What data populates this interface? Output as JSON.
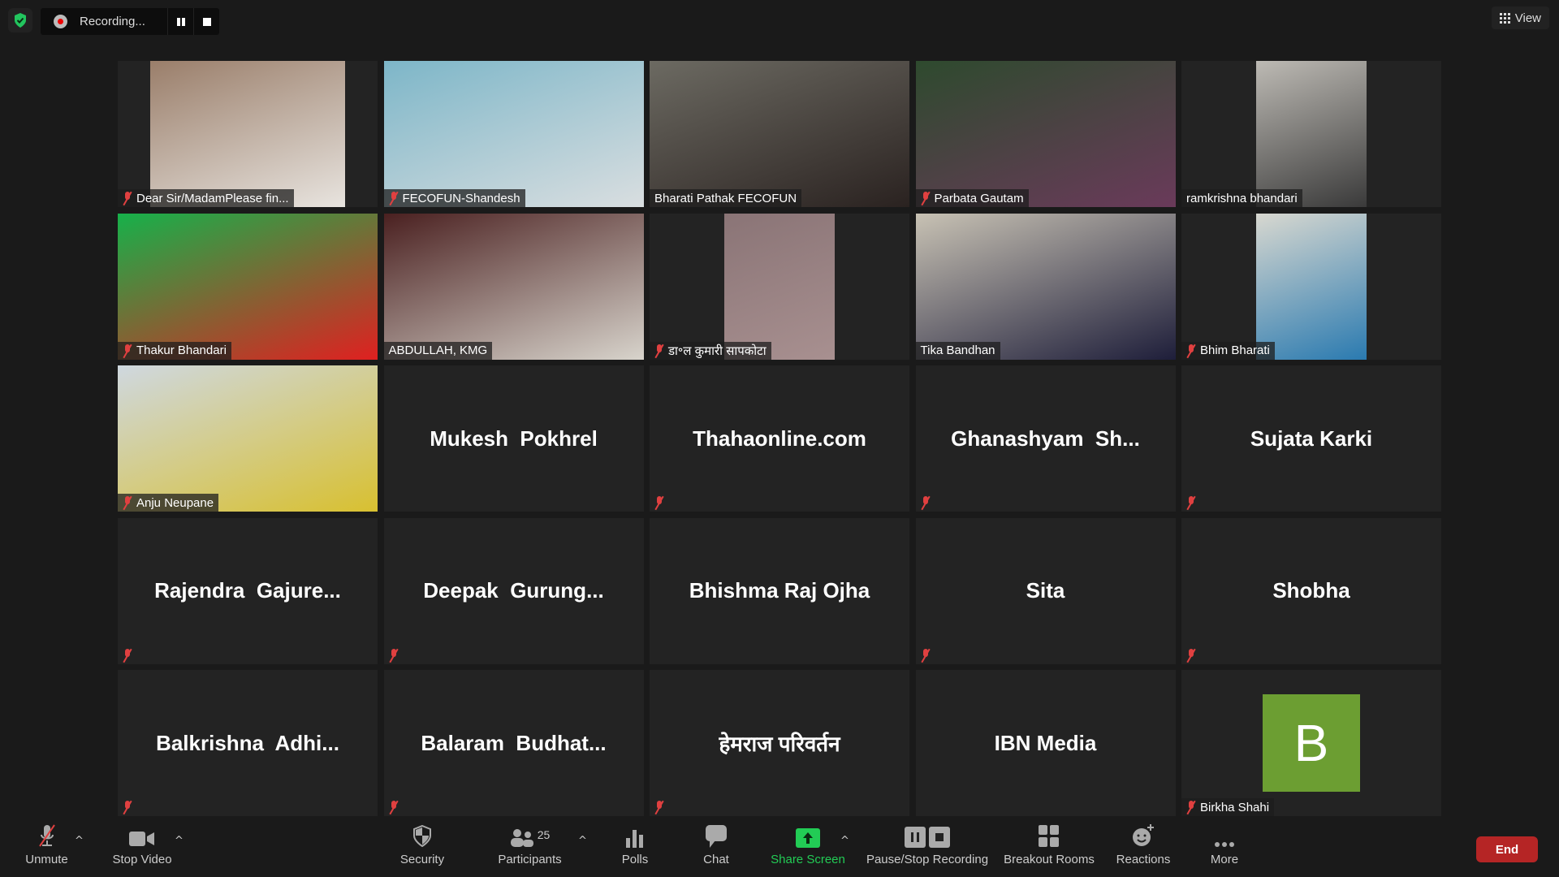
{
  "topbar": {
    "security_icon": "shield-check-icon",
    "recording_label": "Recording...",
    "view_label": "View"
  },
  "tiles": [
    {
      "name": "Dear Sir/MadamPlease fin...",
      "muted": true,
      "video": true,
      "colors": [
        "#9a7e6a",
        "#e8e4df"
      ]
    },
    {
      "name": "FECOFUN-Shandesh",
      "muted": true,
      "video": true,
      "colors": [
        "#7db6c8",
        "#d9dee0"
      ]
    },
    {
      "name": "Bharati Pathak FECOFUN",
      "muted": false,
      "video": true,
      "colors": [
        "#6c6a62",
        "#2a2220"
      ]
    },
    {
      "name": "Parbata Gautam",
      "muted": true,
      "video": true,
      "colors": [
        "#2e4a2e",
        "#6a3a5a"
      ]
    },
    {
      "name": "ramkrishna bhandari",
      "muted": false,
      "video": true,
      "colors": [
        "#bdbab4",
        "#3a3a3a"
      ]
    },
    {
      "name": "Thakur Bhandari",
      "muted": true,
      "video": true,
      "colors": [
        "#16b14a",
        "#e02020"
      ]
    },
    {
      "name": "ABDULLAH, KMG",
      "muted": false,
      "video": true,
      "colors": [
        "#4a2020",
        "#d8d4cc"
      ]
    },
    {
      "name": "डा॰ल कुमारी सापकोटा",
      "muted": true,
      "video": true,
      "colors": [
        "#8a7476",
        "#a89090"
      ]
    },
    {
      "name": "Tika Bandhan",
      "muted": false,
      "video": true,
      "active": true,
      "colors": [
        "#c8c2b4",
        "#1e1e3a"
      ]
    },
    {
      "name": "Bhim Bharati",
      "muted": true,
      "video": true,
      "colors": [
        "#d8d8d0",
        "#2a7ab0"
      ]
    },
    {
      "name": "Anju Neupane",
      "muted": true,
      "video": true,
      "colors": [
        "#cfd8e0",
        "#d8c030"
      ]
    },
    {
      "display": "Mukesh  Pokhrel",
      "muted": false
    },
    {
      "display": "Thahaonline.com",
      "muted": true
    },
    {
      "display": "Ghanashyam  Sh...",
      "muted": true
    },
    {
      "display": "Sujata Karki",
      "muted": true
    },
    {
      "display": "Rajendra  Gajure...",
      "muted": true
    },
    {
      "display": "Deepak  Gurung...",
      "muted": true
    },
    {
      "display": "Bhishma Raj Ojha",
      "muted": false
    },
    {
      "display": "Sita",
      "muted": true
    },
    {
      "display": "Shobha",
      "muted": true
    },
    {
      "display": "Balkrishna  Adhi...",
      "muted": true
    },
    {
      "display": "Balaram  Budhat...",
      "muted": true
    },
    {
      "display": "हेमराज परिवर्तन",
      "muted": true
    },
    {
      "display": "IBN Media",
      "muted": false
    },
    {
      "name": "Birkha Shahi",
      "muted": true,
      "avatar": "B",
      "avatar_color": "#6c9e32"
    }
  ],
  "toolbar": {
    "unmute": "Unmute",
    "stop_video": "Stop Video",
    "security": "Security",
    "participants": "Participants",
    "participants_count": "25",
    "polls": "Polls",
    "chat": "Chat",
    "share_screen": "Share Screen",
    "pause_stop_recording": "Pause/Stop Recording",
    "breakout_rooms": "Breakout Rooms",
    "reactions": "Reactions",
    "more": "More",
    "end": "End",
    "share_color": "#22cc55",
    "end_color": "#b52525"
  }
}
